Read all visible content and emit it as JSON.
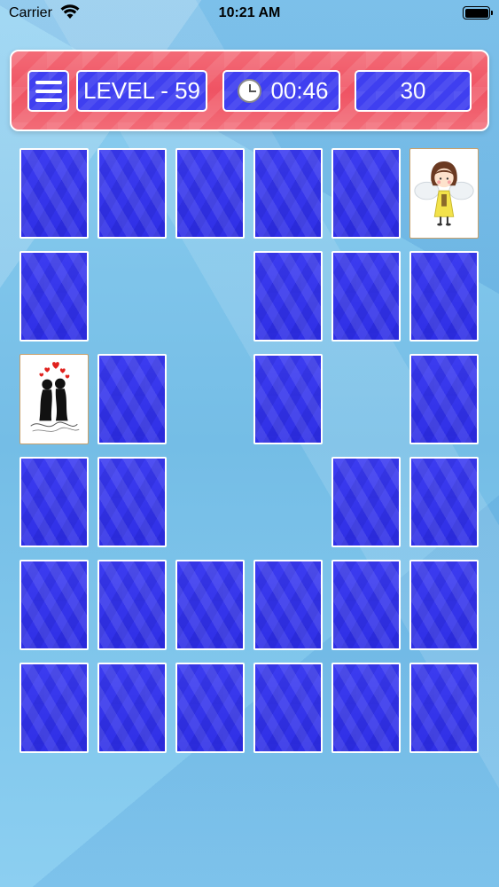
{
  "status_bar": {
    "carrier": "Carrier",
    "time": "10:21 AM"
  },
  "header": {
    "level_label": "LEVEL - 59",
    "timer": "00:46",
    "score": "30"
  },
  "board": {
    "columns": 6,
    "rows": 6,
    "cells": [
      "back",
      "back",
      "back",
      "back",
      "back",
      "angel",
      "back",
      "empty",
      "empty",
      "back",
      "back",
      "back",
      "couple",
      "back",
      "empty",
      "back",
      "empty",
      "back",
      "back",
      "back",
      "empty",
      "empty",
      "back",
      "back",
      "back",
      "back",
      "back",
      "back",
      "back",
      "back",
      "back",
      "back",
      "back",
      "back",
      "back",
      "back"
    ]
  },
  "colors": {
    "header_red": "#ef5363",
    "card_blue": "#3434ec",
    "background": "#7cc4ea"
  }
}
